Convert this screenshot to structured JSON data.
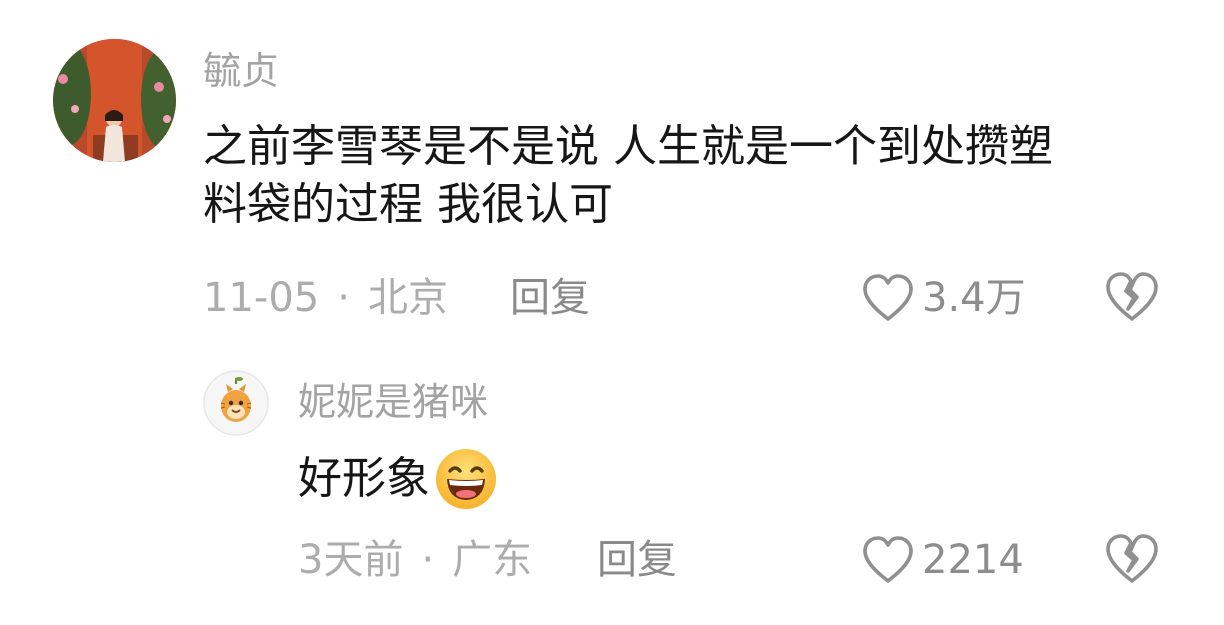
{
  "comment": {
    "username": "毓贞",
    "text_line1": "之前李雪琴是不是说 人生就是一个到处攒塑",
    "text_line2": "料袋的过程 我很认可",
    "date": "11-05",
    "separator": "·",
    "location": "北京",
    "reply_label": "回复",
    "like_count": "3.4万",
    "avatar_icon": "user-avatar-photo",
    "like_icon": "heart-outline-icon",
    "dislike_icon": "broken-heart-icon"
  },
  "reply": {
    "username": "妮妮是猪咪",
    "text": "好形象",
    "emoji_icon": "grinning-face-emoji",
    "date": "3天前",
    "separator": "·",
    "location": "广东",
    "reply_label": "回复",
    "like_count": "2214",
    "avatar_icon": "cartoon-cat-avatar",
    "like_icon": "heart-outline-icon",
    "dislike_icon": "broken-heart-icon"
  },
  "colors": {
    "username": "#a3a3a3",
    "body_text": "#161616",
    "meta_text": "#acacac",
    "reply_text": "#8a8a8a",
    "icon_stroke": "#909090"
  }
}
